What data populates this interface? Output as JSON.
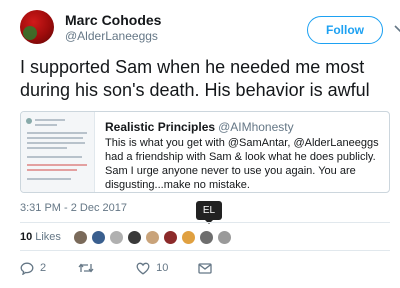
{
  "author": {
    "name": "Marc Cohodes",
    "handle": "@AlderLaneeggs"
  },
  "follow_label": "Follow",
  "tweet_text": "I supported Sam when he needed me most during his son's death. His behavior is awful",
  "quoted": {
    "name": "Realistic Principles",
    "handle": "@AIMhonesty",
    "text": "This is what you get with @SamAntar, @AlderLaneeggs had a friendship with Sam & look what he does publicly. Sam I urge anyone never to use you again. You are disgusting...make no mistake."
  },
  "timestamp": "3:31 PM - 2 Dec 2017",
  "tooltip": "EL",
  "likes": {
    "count": "10",
    "label": "Likes",
    "avatar_colors": [
      "#7a6a5a",
      "#3a5f8f",
      "#b0b0b0",
      "#3a3a3a",
      "#c9a37a",
      "#8c2a2a",
      "#e0a040",
      "#6e6e6e",
      "#9a9a9a"
    ]
  },
  "actions": {
    "replies": "2",
    "retweets": "",
    "likes": "10"
  },
  "colors": {
    "accent": "#1da1f2",
    "muted": "#657786"
  }
}
